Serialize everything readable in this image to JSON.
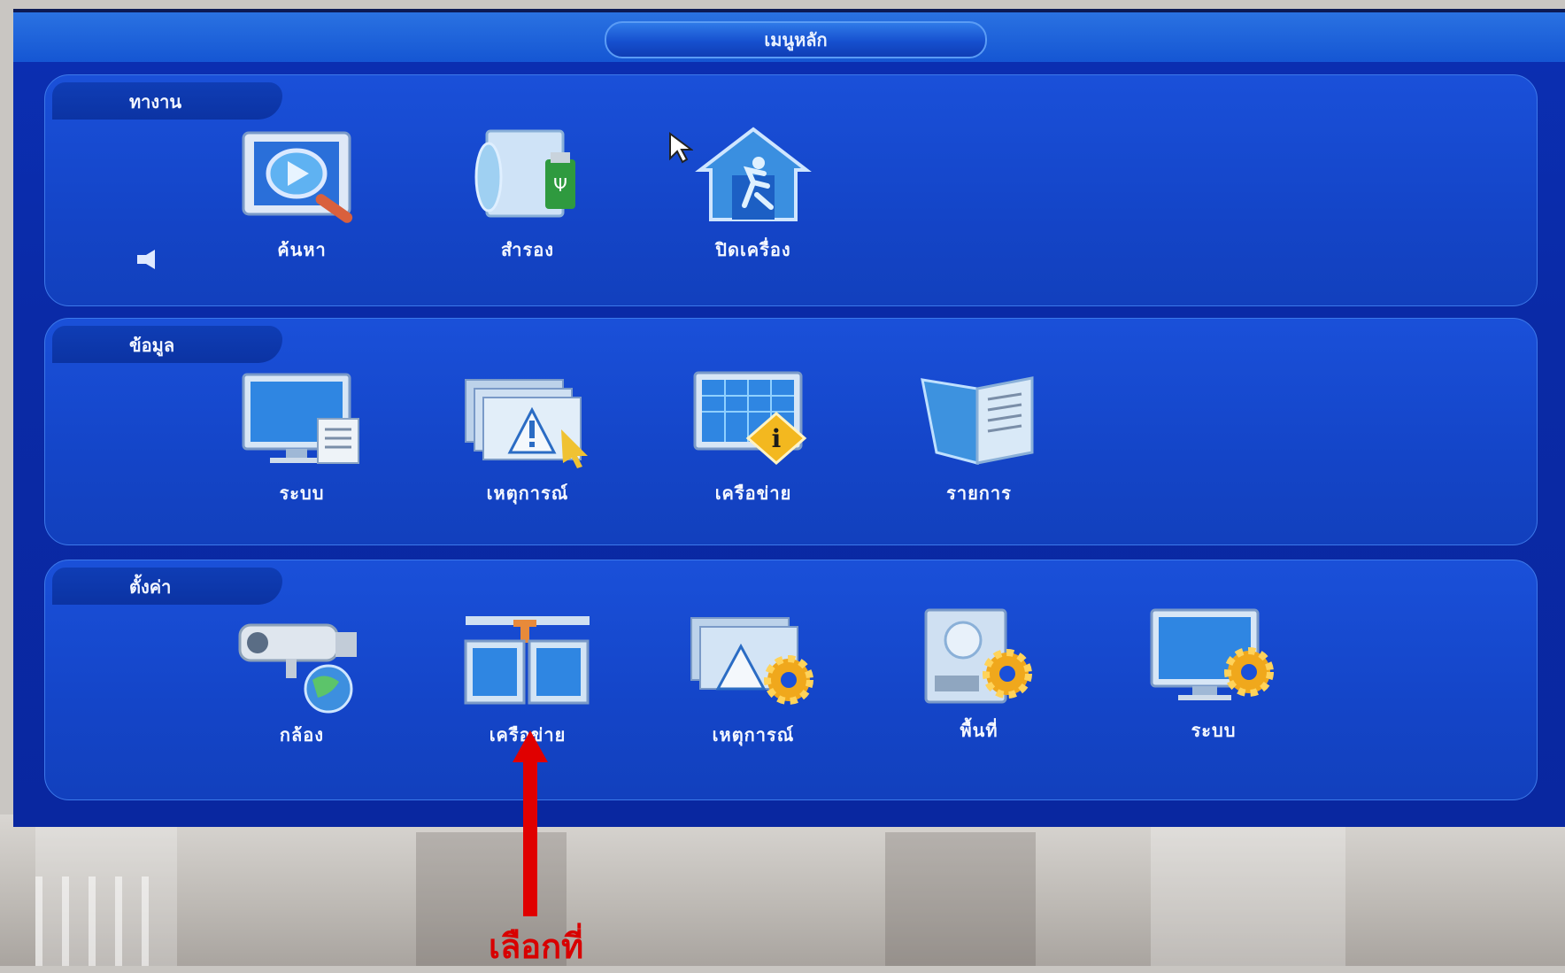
{
  "window": {
    "title": "เมนูหลัก"
  },
  "sections": [
    {
      "label": "ทางาน",
      "items": [
        {
          "label": "ค้นหา",
          "icon": "video-search-icon"
        },
        {
          "label": "สำรอง",
          "icon": "backup-icon"
        },
        {
          "label": "ปิดเครื่อง",
          "icon": "shutdown-icon"
        }
      ]
    },
    {
      "label": "ข้อมูล",
      "items": [
        {
          "label": "ระบบ",
          "icon": "system-info-icon"
        },
        {
          "label": "เหตุการณ์",
          "icon": "event-info-icon"
        },
        {
          "label": "เครือข่าย",
          "icon": "network-info-icon"
        },
        {
          "label": "รายการ",
          "icon": "log-icon"
        }
      ]
    },
    {
      "label": "ตั้งค่า",
      "items": [
        {
          "label": "กล้อง",
          "icon": "camera-icon"
        },
        {
          "label": "เครือข่าย",
          "icon": "network-settings-icon"
        },
        {
          "label": "เหตุการณ์",
          "icon": "event-settings-icon"
        },
        {
          "label": "พื้นที่",
          "icon": "storage-settings-icon"
        },
        {
          "label": "ระบบ",
          "icon": "system-settings-icon"
        }
      ]
    }
  ],
  "annotation": {
    "text": "เลือกที่",
    "color": "#e00000"
  },
  "colors": {
    "background": "#0b2fb3",
    "panel": "#1a50d9",
    "accent": "#2f7ae8"
  }
}
